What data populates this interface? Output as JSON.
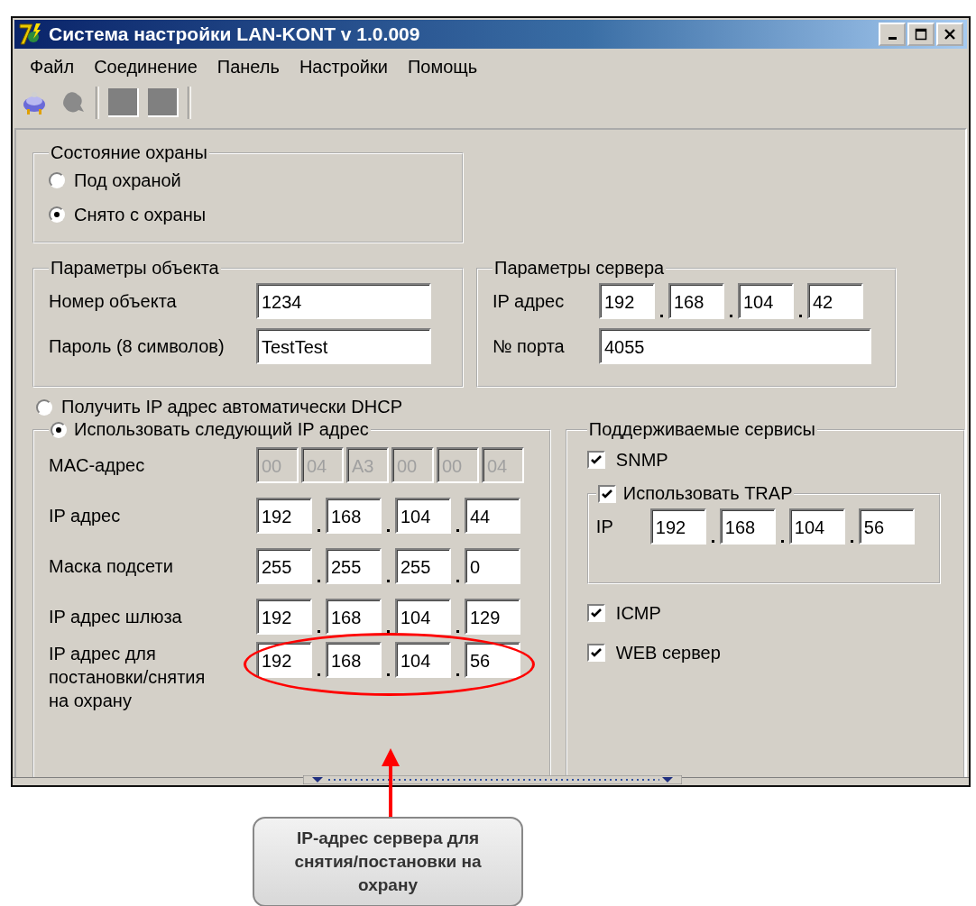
{
  "window": {
    "title": "Система настройки LAN-KONT v 1.0.009"
  },
  "menu": [
    "Файл",
    "Соединение",
    "Панель",
    "Настройки",
    "Помощь"
  ],
  "toolbar": [
    {
      "kind": "connect",
      "disabled": false
    },
    {
      "kind": "disconnect",
      "disabled": true
    },
    {
      "kind": "square",
      "disabled": true
    },
    {
      "kind": "square",
      "disabled": true
    }
  ],
  "guard": {
    "title": "Состояние охраны",
    "options": [
      {
        "label": "Под охраной",
        "selected": false
      },
      {
        "label": "Снято с охраны",
        "selected": true
      }
    ]
  },
  "object_params": {
    "title": "Параметры объекта",
    "fields": [
      {
        "label": "Номер объекта",
        "value": "1234"
      },
      {
        "label": "Пароль (8 символов)",
        "value": "TestTest"
      }
    ]
  },
  "server_params": {
    "title": "Параметры сервера",
    "ip_label": "IP адрес",
    "ip": [
      "192",
      "168",
      "104",
      "42"
    ],
    "port_label": "№ порта",
    "port": "4055"
  },
  "ip_mode": [
    {
      "label": "Получить IP адрес автоматически DHCP",
      "selected": false
    },
    {
      "label": "Использовать следующий IP адрес",
      "selected": true
    }
  ],
  "network": {
    "rows": [
      {
        "label": "MAC-адрес",
        "kind": "mac",
        "disabled": true,
        "highlighted": false,
        "values": [
          "00",
          "04",
          "A3",
          "00",
          "00",
          "04"
        ]
      },
      {
        "label": "IP адрес",
        "kind": "ip",
        "disabled": false,
        "highlighted": false,
        "values": [
          "192",
          "168",
          "104",
          "44"
        ]
      },
      {
        "label": "Маска подсети",
        "kind": "ip",
        "disabled": false,
        "highlighted": false,
        "values": [
          "255",
          "255",
          "255",
          "0"
        ]
      },
      {
        "label": "IP адрес шлюза",
        "kind": "ip",
        "disabled": false,
        "highlighted": false,
        "values": [
          "192",
          "168",
          "104",
          "129"
        ]
      },
      {
        "label": "IP адрес для постановки/снятия на охрану",
        "kind": "ip",
        "disabled": false,
        "highlighted": true,
        "values": [
          "192",
          "168",
          "104",
          "56"
        ]
      }
    ]
  },
  "services": {
    "title": "Поддерживаемые сервисы",
    "items": [
      {
        "kind": "checkbox",
        "label": "SNMP",
        "checked": true
      },
      {
        "kind": "group",
        "label": "Использовать TRAP",
        "checked": true,
        "ip_label": "IP",
        "ip": [
          "192",
          "168",
          "104",
          "56"
        ]
      },
      {
        "kind": "checkbox",
        "label": "ICMP",
        "checked": true
      },
      {
        "kind": "checkbox",
        "label": "WEB сервер",
        "checked": true
      }
    ]
  },
  "annotation": {
    "text": "IP-адрес сервера для снятия/постановки на охрану"
  }
}
